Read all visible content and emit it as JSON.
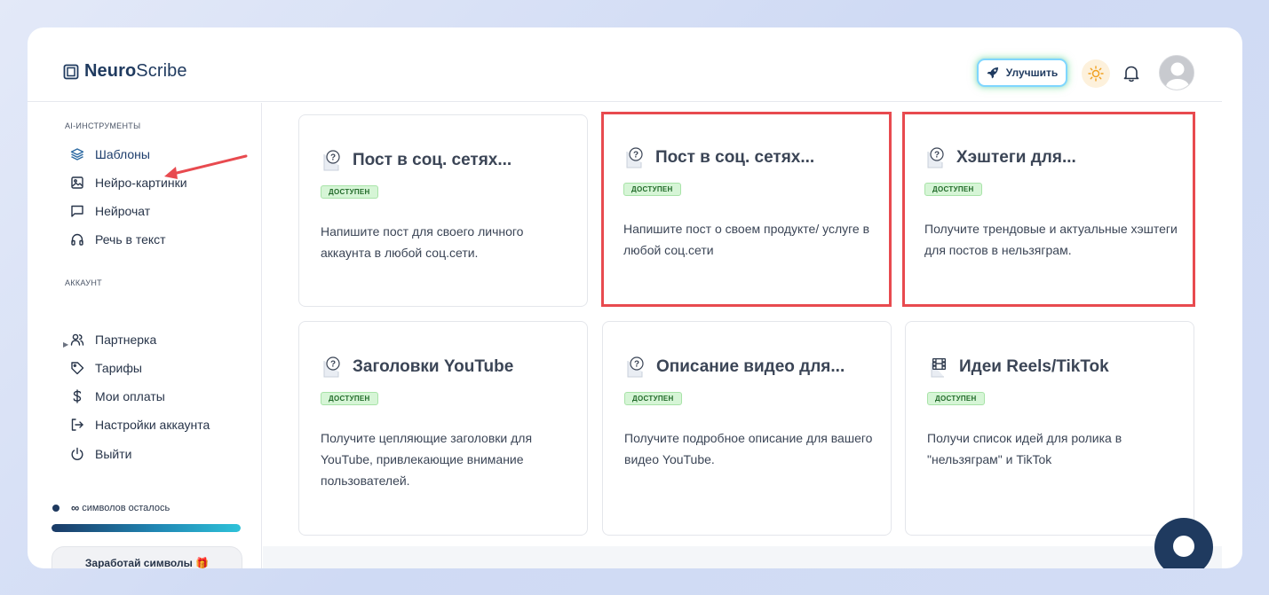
{
  "app": {
    "logo_bold": "Neuro",
    "logo_regular": "Scribe"
  },
  "header": {
    "upgrade_label": "Улучшить",
    "icons": [
      "rocket-icon",
      "sun-icon",
      "bell-icon",
      "avatar"
    ]
  },
  "sidebar": {
    "section_tools": "AI-ИНСТРУМЕНТЫ",
    "tools": [
      {
        "label": "Шаблоны",
        "icon": "layers-icon",
        "active": true
      },
      {
        "label": "Нейро-картинки",
        "icon": "image-icon"
      },
      {
        "label": "Нейрочат",
        "icon": "chat-icon"
      },
      {
        "label": "Речь в текст",
        "icon": "headphones-icon"
      }
    ],
    "section_account": "АККАУНТ",
    "account": [
      {
        "label": "Партнерка",
        "icon": "users-icon"
      },
      {
        "label": "Тарифы",
        "icon": "tag-icon"
      },
      {
        "label": "Мои оплаты",
        "icon": "dollar-icon"
      },
      {
        "label": "Настройки аккаунта",
        "icon": "logout-arrow-icon"
      },
      {
        "label": "Выйти",
        "icon": "power-icon"
      }
    ],
    "chars_symbol": "∞",
    "chars_label": "символов осталось",
    "progress_fraction": 1.0,
    "earn_label": "Заработай символы 🎁"
  },
  "cards": [
    {
      "title": "Пост в соц. сетях...",
      "badge": "ДОСТУПЕН",
      "desc": "Напишите пост для своего личного аккаунта в любой соц.сети.",
      "icon": "question-note-icon",
      "highlighted": false
    },
    {
      "title": "Пост в соц. сетях...",
      "badge": "ДОСТУПЕН",
      "desc": "Напишите пост о своем продукте/ услуге в любой соц.сети",
      "icon": "question-note-icon",
      "highlighted": true
    },
    {
      "title": "Хэштеги для...",
      "badge": "ДОСТУПЕН",
      "desc": "Получите трендовые и актуальные хэштеги для постов в нельзяграм.",
      "icon": "question-note-icon",
      "highlighted": true
    },
    {
      "title": "Заголовки YouTube",
      "badge": "ДОСТУПЕН",
      "desc": "Получите цепляющие заголовки для YouTube, привлекающие внимание пользователей.",
      "icon": "question-note-icon",
      "highlighted": false
    },
    {
      "title": "Описание видео для...",
      "badge": "ДОСТУПЕН",
      "desc": "Получите подробное описание для вашего видео YouTube.",
      "icon": "question-note-icon",
      "highlighted": false
    },
    {
      "title": "Идеи Reels/TikTok",
      "badge": "ДОСТУПЕН",
      "desc": "Получи список идей для ролика в \"нельзяграм\" и TikTok",
      "icon": "film-icon",
      "highlighted": false
    }
  ],
  "colors": {
    "brand": "#1f3a5f",
    "highlight": "#e84a4f",
    "badge_bg": "#d6f5d6"
  }
}
